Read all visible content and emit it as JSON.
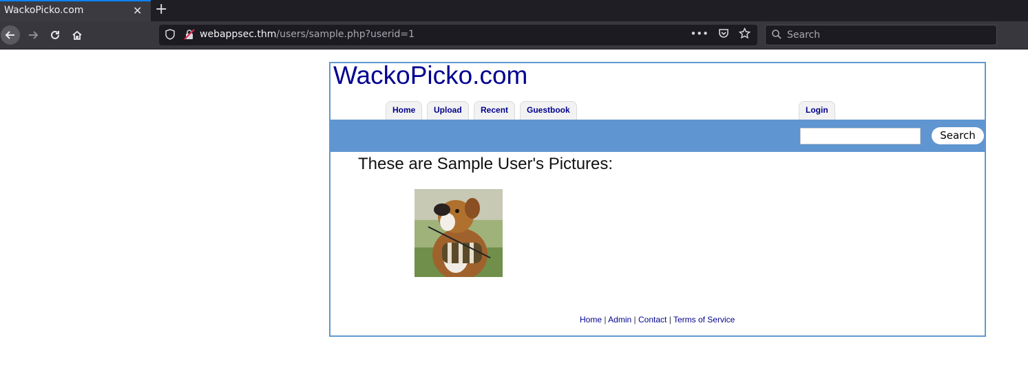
{
  "browser": {
    "tab_title": "WackoPicko.com",
    "tab_close": "✕",
    "new_tab": "+",
    "url_host": "webappsec.thm",
    "url_path": "/users/sample.php?userid=1",
    "search_placeholder": "Search",
    "more_actions": "•••"
  },
  "site": {
    "title": "WackoPicko.com",
    "nav": [
      "Home",
      "Upload",
      "Recent",
      "Guestbook"
    ],
    "login": "Login",
    "search_button": "Search",
    "search_value": "",
    "heading": "These are Sample User's Pictures:",
    "footer": {
      "links": [
        "Home",
        "Admin",
        "Contact",
        "Terms of Service"
      ],
      "separator": "|"
    }
  },
  "colors": {
    "band": "#5f95d0",
    "link": "#00008b",
    "title": "#000090"
  }
}
